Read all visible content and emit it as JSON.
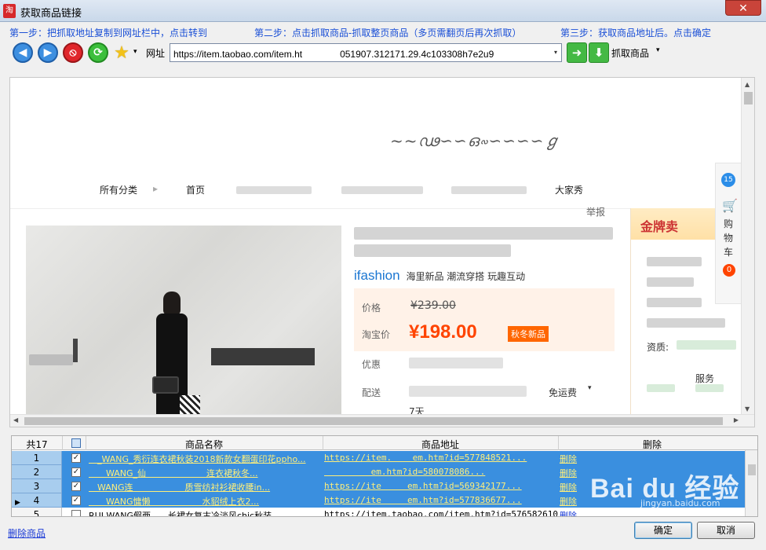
{
  "window": {
    "title": "获取商品链接",
    "close_glyph": "✕"
  },
  "steps": {
    "step1": "第一步：把抓取地址复制到网址栏中，点击转到",
    "step2": "第二步：点击抓取商品-抓取整页商品（多页需翻页后再次抓取）",
    "step3": "第三步：获取商品地址后。点击确定"
  },
  "toolbar": {
    "back_glyph": "◀",
    "forward_glyph": "▶",
    "stop_glyph": "⦸",
    "refresh_glyph": "⟳",
    "favorite_glyph": "★",
    "address_label": "网址",
    "address_value": "https://item.taobao.com/item.ht    051907.312171.29.4c103308h7e2u9",
    "go_glyph": "➜",
    "download_glyph": "⬇",
    "grab_label": "抓取商品",
    "dropdown_glyph": "▾"
  },
  "browser": {
    "nav": {
      "all_categories": "所有分类",
      "home": "首页",
      "item_last": "大家秀"
    },
    "report": "举报",
    "brand_logo": "ifashion",
    "brand_tagline": "海里新品 潮流穿搭 玩趣互动",
    "price_label": "价格",
    "old_price": "¥239.00",
    "taobao_price_label": "淘宝价",
    "new_price": "¥198.00",
    "promo": "秋冬新品",
    "discount_label": "优惠",
    "shipping_label": "配送",
    "shipping_value": "免运费",
    "shipping_days": "7天",
    "side_gold": "金牌卖",
    "side_qual": "资质:",
    "side_service": "服务",
    "cart_bubble": "15",
    "cart_text": "购物车",
    "cart_count": "0"
  },
  "grid": {
    "total_label": "共17",
    "col_name": "商品名称",
    "col_url": "商品地址",
    "col_delete": "删除",
    "rows": [
      {
        "num": "1",
        "name": " _WANG_秀衍连衣裙秋装2018新款女翻蛋印花ppho...",
        "url": "https://item.    em.htm?id=577848521...",
        "delete": "删除"
      },
      {
        "num": "2",
        "name": "  WANG_仙       连衣裙秋冬...",
        "url": "         em.htm?id=580078086...",
        "delete": "删除"
      },
      {
        "num": "3",
        "name": " WANG连      质雪纺衬衫裙收腰in...",
        "url": "https://ite     em.htm?id=569342177...",
        "delete": "删除"
      },
      {
        "num": "4",
        "name": "  WANG慵懒      水貂绒上衣2...",
        "url": "https://ite     em.htm?id=577836677...",
        "delete": "删除"
      },
      {
        "num": "5",
        "name": "RUI WANG假两  长裙女复古冷淡风chic秋装",
        "url": "https://item.taobao.com/item.htm?id=576582610029",
        "delete": "删除"
      }
    ]
  },
  "footer": {
    "delete_link": "删除商品",
    "ok_label": "确定",
    "cancel_label": "取消"
  },
  "watermark": {
    "main": "Bai du 经验",
    "sub": "jingyan.baidu.com"
  }
}
